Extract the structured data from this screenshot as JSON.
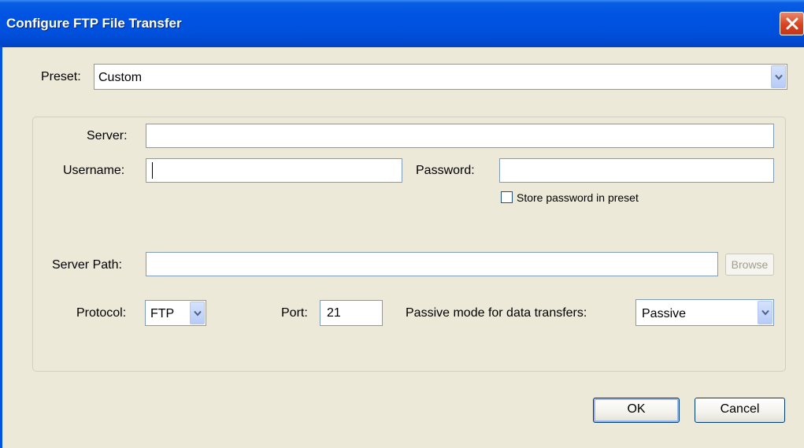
{
  "window": {
    "title": "Configure FTP File Transfer"
  },
  "preset": {
    "label": "Preset:",
    "value": "Custom"
  },
  "server": {
    "label": "Server:",
    "value": ""
  },
  "username": {
    "label": "Username:",
    "value": ""
  },
  "password": {
    "label": "Password:",
    "value": "",
    "store_label": "Store password in preset",
    "store_checked": false
  },
  "server_path": {
    "label": "Server Path:",
    "value": "",
    "browse_label": "Browse"
  },
  "protocol": {
    "label": "Protocol:",
    "value": "FTP"
  },
  "port": {
    "label": "Port:",
    "value": "21"
  },
  "passive": {
    "label": "Passive mode for data transfers:",
    "value": "Passive"
  },
  "buttons": {
    "ok": "OK",
    "cancel": "Cancel"
  },
  "colors": {
    "titlebar": "#0054e3",
    "dialog_bg": "#ece9d8",
    "field_border": "#7f9db9",
    "close": "#d8431f"
  },
  "icons": {
    "close": "close-icon",
    "dropdown": "chevron-down-icon"
  }
}
